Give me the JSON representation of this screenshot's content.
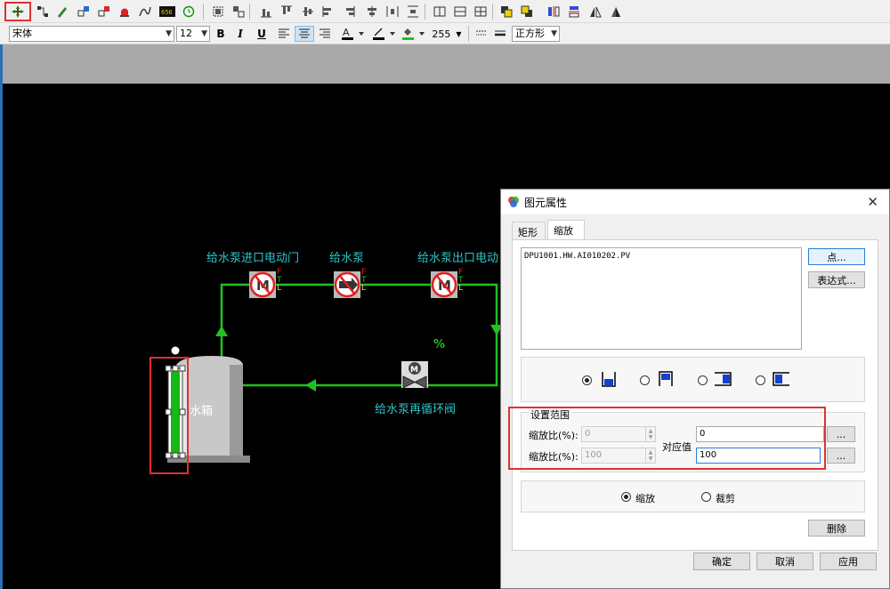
{
  "toolbar_top": {
    "icons": [
      "pointer-icon",
      "connect-icon",
      "pen-icon",
      "ungroup-icon",
      "group-icon",
      "alarm-icon",
      "curve-icon",
      "numeric-display-icon",
      "clock-icon"
    ],
    "align_icons": [
      "group-box-icon",
      "ungroup-box-icon",
      "align-bottom-icon",
      "align-top-icon",
      "align-middle-icon",
      "align-left-icon",
      "align-right-icon",
      "align-center-icon",
      "distribute-h-icon",
      "distribute-v-icon",
      "grid-1-icon",
      "grid-2-icon",
      "grid-4-icon",
      "front-icon",
      "back-icon",
      "flip-h-icon",
      "flip-v-icon",
      "rotate-icon",
      "mirror-icon"
    ]
  },
  "toolbar_format": {
    "font_name": "宋体",
    "font_size": "12",
    "bold": "B",
    "italic": "I",
    "underline": "U",
    "line_width": "255",
    "shape_select": "正方形"
  },
  "canvas": {
    "labels": {
      "inlet_valve": "给水泵进口电动门",
      "pump": "给水泵",
      "outlet_valve": "给水泵出口电动",
      "recirc_valve": "给水泵再循环阀",
      "tank": "水箱",
      "percent": "%"
    },
    "ftl": [
      "F",
      "T",
      "L"
    ],
    "valve_letter": "M",
    "colors": {
      "pipe": "#22c022",
      "label": "#2ec4c8",
      "level": "#16b816"
    }
  },
  "dialog": {
    "title": "图元属性",
    "close": "✕",
    "tabs": [
      "矩形",
      "缩放"
    ],
    "point_expr": "DPU1001.HW.AI010202.PV",
    "point_button": "点...",
    "expr_button": "表达式...",
    "range_title": "设置范围",
    "scale_label_1": "缩放比(%):",
    "scale_value_1": "0",
    "scale_label_2": "缩放比(%):",
    "scale_value_2": "100",
    "map_label": "对应值",
    "map_value_1": "0",
    "map_value_2": "100",
    "browse": "...",
    "mode_scale": "缩放",
    "mode_clip": "裁剪",
    "delete_button": "删除",
    "ok_button": "确定",
    "cancel_button": "取消",
    "apply_button": "应用"
  }
}
